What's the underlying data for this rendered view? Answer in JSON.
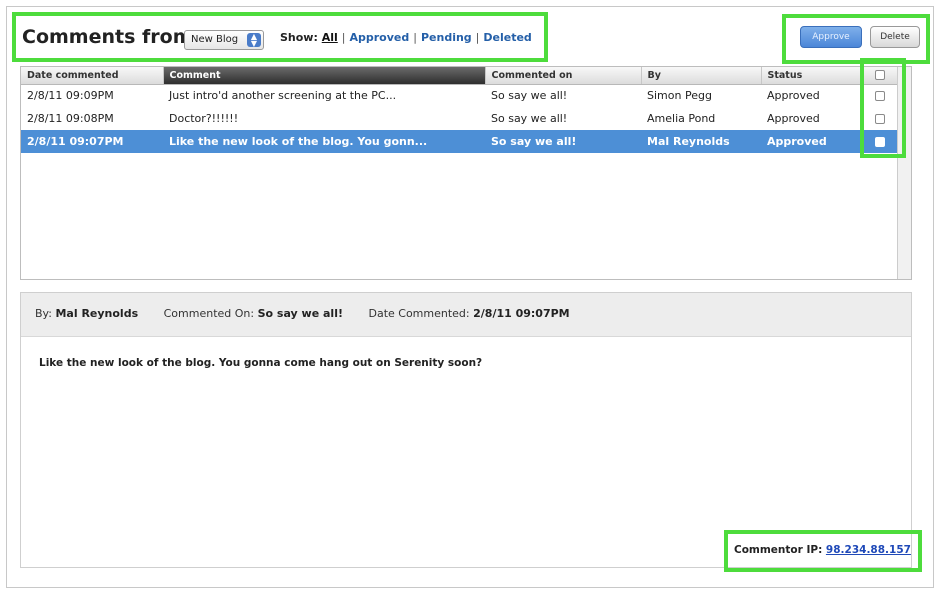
{
  "header": {
    "title": "Comments from",
    "blog_select": "New Blog",
    "show_label": "Show:",
    "filters": [
      "All",
      "Approved",
      "Pending",
      "Deleted"
    ],
    "approve_label": "Approve",
    "delete_label": "Delete"
  },
  "table": {
    "columns": [
      "Date commented",
      "Comment",
      "Commented on",
      "By",
      "Status"
    ],
    "rows": [
      {
        "date": "2/8/11 09:09PM",
        "comment": "Just intro'd another screening at the PC...",
        "on": "So say we all!",
        "by": "Simon Pegg",
        "status": "Approved"
      },
      {
        "date": "2/8/11 09:08PM",
        "comment": "Doctor?!!!!!!",
        "on": "So say we all!",
        "by": "Amelia Pond",
        "status": "Approved"
      },
      {
        "date": "2/8/11 09:07PM",
        "comment": "Like the new look of the blog. You gonn...",
        "on": "So say we all!",
        "by": "Mal Reynolds",
        "status": "Approved"
      }
    ]
  },
  "detail": {
    "by_label": "By:",
    "by_value": "Mal Reynolds",
    "on_label": "Commented On:",
    "on_value": "So say we all!",
    "date_label": "Date Commented:",
    "date_value": "2/8/11 09:07PM",
    "body": "Like the new look of the blog. You gonna come hang out on Serenity soon?",
    "ip_label": "Commentor IP:",
    "ip_value": "98.234.88.157"
  },
  "colors": {
    "highlight": "#4ddc3c",
    "selection": "#4d8fd6",
    "link": "#245fa8"
  }
}
